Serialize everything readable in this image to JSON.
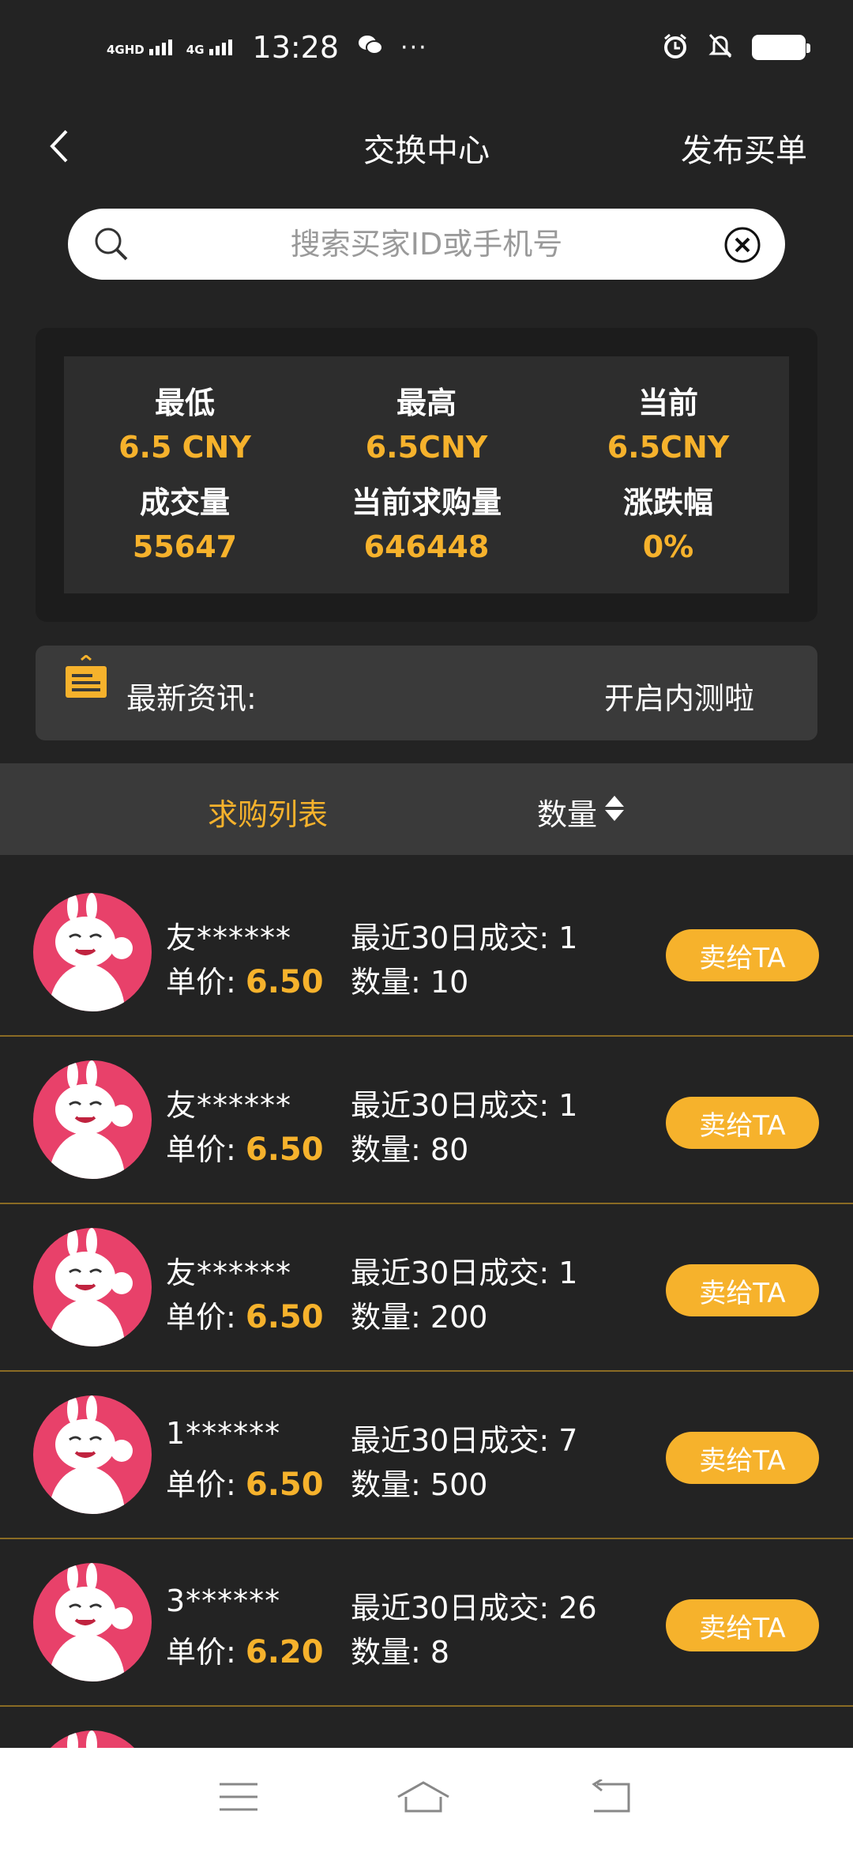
{
  "status_bar": {
    "network1": "4GHD",
    "network2": "4G",
    "time": "13:28",
    "dots": "···",
    "battery": "81"
  },
  "nav": {
    "title": "交换中心",
    "action": "发布买单"
  },
  "search": {
    "placeholder": "搜索买家ID或手机号"
  },
  "stats": [
    {
      "label": "最低",
      "value": "6.5 CNY"
    },
    {
      "label": "最高",
      "value": "6.5CNY"
    },
    {
      "label": "当前",
      "value": "6.5CNY"
    },
    {
      "label": "成交量",
      "value": "55647"
    },
    {
      "label": "当前求购量",
      "value": "646448"
    },
    {
      "label": "涨跌幅",
      "value": "0%"
    }
  ],
  "news": {
    "label": "最新资讯:",
    "text": "开启内测啦"
  },
  "tabs": {
    "list": "求购列表",
    "quantity": "数量"
  },
  "list_labels": {
    "price_prefix": "单价:",
    "deals_prefix": "最近30日成交:",
    "qty_prefix": "数量:",
    "sell_button": "卖给TA"
  },
  "orders": [
    {
      "user": "友******",
      "price": "6.50",
      "deals": "1",
      "qty": "10"
    },
    {
      "user": "友******",
      "price": "6.50",
      "deals": "1",
      "qty": "80"
    },
    {
      "user": "友******",
      "price": "6.50",
      "deals": "1",
      "qty": "200"
    },
    {
      "user": "1******",
      "price": "6.50",
      "deals": "7",
      "qty": "500"
    },
    {
      "user": "3******",
      "price": "6.20",
      "deals": "26",
      "qty": "8"
    }
  ],
  "colors": {
    "accent": "#f6b22c",
    "background": "#232323",
    "panel": "#2d2d2d"
  },
  "icons": [
    "back-arrow-icon",
    "search-icon",
    "clear-icon",
    "notice-board-icon",
    "sort-icon",
    "menu-icon",
    "home-icon",
    "return-icon"
  ]
}
